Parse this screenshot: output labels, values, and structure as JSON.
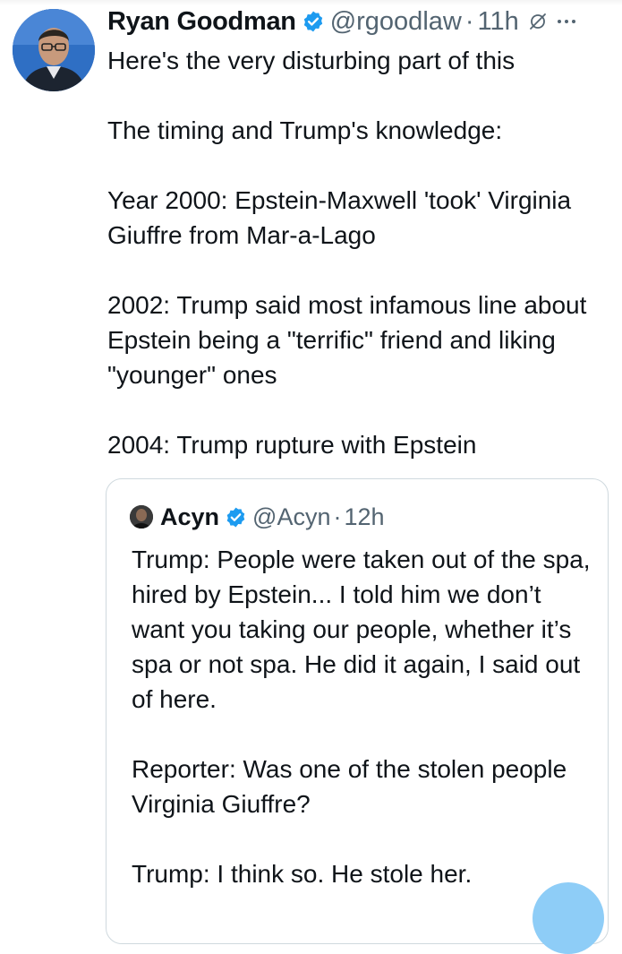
{
  "tweet": {
    "author": {
      "name": "Ryan Goodman",
      "handle": "@rgoodlaw",
      "verified": true,
      "avatar_icon": "profile-photo"
    },
    "separator": "·",
    "time": "11h",
    "grok_icon": "grok-icon",
    "more_icon": "more-icon",
    "text": "Here's the very disturbing part of this\n\nThe timing and Trump's knowledge:\n\nYear 2000: Epstein-Maxwell 'took' Virginia Giuffre from Mar-a-Lago\n\n2002: Trump said most infamous line about Epstein being a \"terrific\" friend and liking \"younger\" ones\n\n2004: Trump rupture with Epstein"
  },
  "quoted_tweet": {
    "author": {
      "name": "Acyn",
      "handle": "@Acyn",
      "verified": true,
      "avatar_icon": "profile-photo"
    },
    "separator": "·",
    "time": "12h",
    "text": "Trump: People were taken out of the spa, hired by Epstein... I told him we don’t want you taking our people, whether it’s spa or not spa. He did it again, I said out of here.\n\nReporter: Was one of the stolen people Virginia Giuffre?\n\nTrump: I think so. He stole her."
  },
  "colors": {
    "text": "#0f1419",
    "secondary_text": "#536471",
    "verified_blue": "#1d9bf0",
    "border": "#cfd9de",
    "fab": "#8ecdf7"
  }
}
